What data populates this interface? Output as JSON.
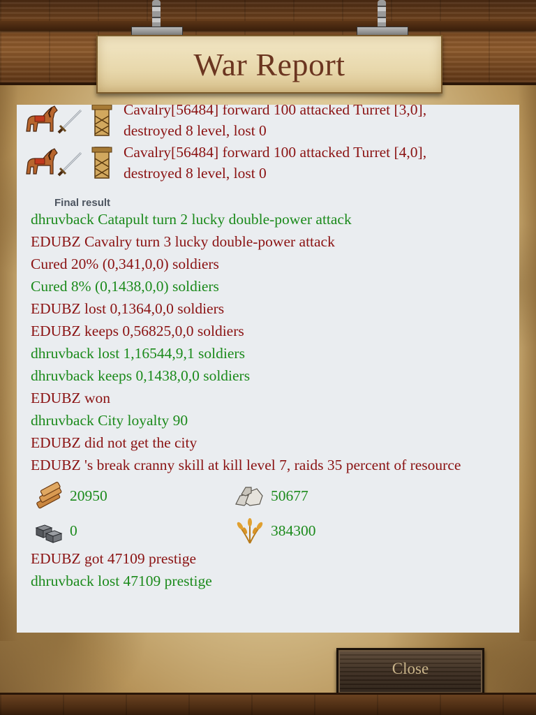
{
  "window": {
    "title": "War Report"
  },
  "battle_log": [
    {
      "unit_icon": "horse-icon",
      "weapon_icon": "sword-icon",
      "target_icon": "turret-icon",
      "line1": "Cavalry[56484] forward 100  attacked Turret [3,0],",
      "line2": "destroyed 8 level, lost 0"
    },
    {
      "unit_icon": "horse-icon",
      "weapon_icon": "sword-icon",
      "target_icon": "turret-icon",
      "line1": "Cavalry[56484] forward 100  attacked Turret [4,0],",
      "line2": "destroyed 8 level, lost 0"
    }
  ],
  "final_result_label": "Final result",
  "results": [
    {
      "text": "dhruvback  Catapult turn 2 lucky double-power attack",
      "color": "green"
    },
    {
      "text": "EDUBZ  Cavalry turn 3 lucky double-power attack",
      "color": "red"
    },
    {
      "text": "Cured 20% (0,341,0,0) soldiers",
      "color": "red"
    },
    {
      "text": "Cured 8% (0,1438,0,0) soldiers",
      "color": "green"
    },
    {
      "text": "EDUBZ lost 0,1364,0,0 soldiers",
      "color": "red"
    },
    {
      "text": "EDUBZ keeps 0,56825,0,0 soldiers",
      "color": "red"
    },
    {
      "text": "dhruvback lost 1,16544,9,1 soldiers",
      "color": "green"
    },
    {
      "text": "dhruvback keeps 0,1438,0,0 soldiers",
      "color": "green"
    },
    {
      "text": "EDUBZ won",
      "color": "red"
    },
    {
      "text": "dhruvback City loyalty 90",
      "color": "green"
    },
    {
      "text": "EDUBZ did not get the city",
      "color": "red"
    },
    {
      "text": "EDUBZ 's break cranny skill at kill level 7, raids 35 percent of resource",
      "color": "red"
    }
  ],
  "resources": {
    "wood": {
      "icon": "wood-icon",
      "value": "20950"
    },
    "stone": {
      "icon": "stone-icon",
      "value": "50677"
    },
    "iron": {
      "icon": "iron-icon",
      "value": "0"
    },
    "food": {
      "icon": "wheat-icon",
      "value": "384300"
    }
  },
  "prestige": [
    {
      "text": "EDUBZ got 47109 prestige",
      "color": "red"
    },
    {
      "text": "dhruvback lost 47109 prestige",
      "color": "green"
    }
  ],
  "close_button": {
    "label": "Close"
  },
  "colors": {
    "red_text": "#8a1212",
    "green_text": "#1b8a1b",
    "panel_bg": "#eaedf0",
    "title_text": "#6b3520"
  }
}
